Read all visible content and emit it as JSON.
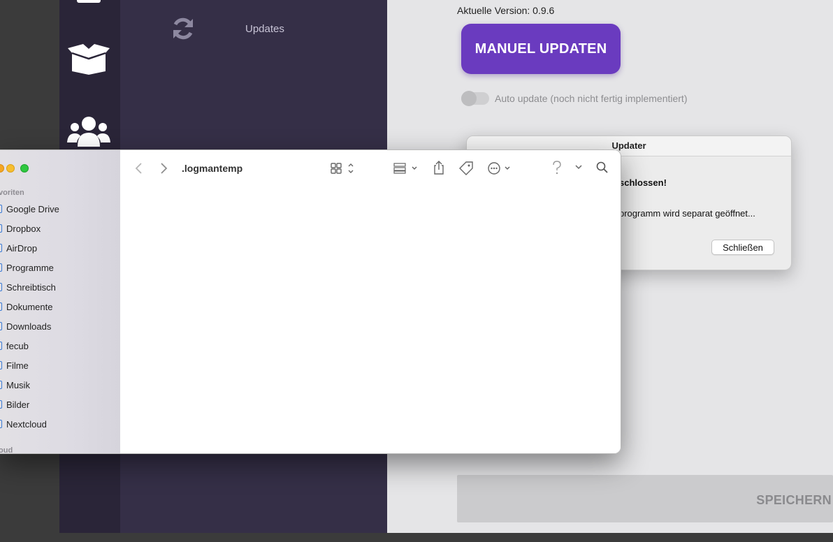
{
  "app": {
    "nav": {
      "updates_label": "Updates"
    },
    "content": {
      "version_text": "Aktuelle Version: 0.9.6",
      "manual_update_label": "MANUEL UPDATEN",
      "auto_update_label": "Auto update (noch nicht fertig implementiert)",
      "auto_update_enabled": false,
      "save_label": "SPEICHERN"
    },
    "accent_color": "#6a3bbf"
  },
  "updater_dialog": {
    "title": "Updater",
    "message_bold": "schlossen!",
    "message": "programm wird separat geöffnet...",
    "close_label": "Schließen"
  },
  "finder": {
    "path_title": ".logmantemp",
    "sidebar": {
      "favorites_label": "voriten",
      "cloud_label": "oud",
      "items": [
        {
          "label": "Google Drive",
          "icon": "folder-icon"
        },
        {
          "label": "Dropbox",
          "icon": "dropbox-icon"
        },
        {
          "label": "AirDrop",
          "icon": "airdrop-icon"
        },
        {
          "label": "Programme",
          "icon": "apps-icon"
        },
        {
          "label": "Schreibtisch",
          "icon": "desktop-icon"
        },
        {
          "label": "Dokumente",
          "icon": "document-icon"
        },
        {
          "label": "Downloads",
          "icon": "download-icon"
        },
        {
          "label": "fecub",
          "icon": "home-icon"
        },
        {
          "label": "Filme",
          "icon": "film-icon"
        },
        {
          "label": "Musik",
          "icon": "music-icon"
        },
        {
          "label": "Bilder",
          "icon": "image-icon"
        },
        {
          "label": "Nextcloud",
          "icon": "folder-icon"
        }
      ]
    }
  }
}
